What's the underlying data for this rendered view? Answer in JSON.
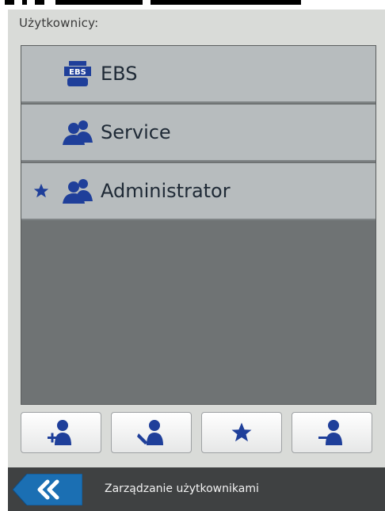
{
  "header": {
    "title": "Użytkownicy:"
  },
  "users": [
    {
      "label": "EBS",
      "icon": "ebs-user-icon",
      "starred": false
    },
    {
      "label": "Service",
      "icon": "users-icon",
      "starred": false
    },
    {
      "label": "Administrator",
      "icon": "users-icon",
      "starred": true
    }
  ],
  "toolbar": {
    "buttons": [
      {
        "icon": "add-user-icon"
      },
      {
        "icon": "edit-user-icon"
      },
      {
        "icon": "star-icon"
      },
      {
        "icon": "remove-user-icon"
      }
    ]
  },
  "bottom_bar": {
    "back_icon": "double-chevron-left-icon",
    "title": "Zarządzanie użytkownikami"
  },
  "colors": {
    "icon_blue": "#1f3f9a",
    "bar_dark": "#3f4142",
    "back_blue": "#1b6fb3"
  }
}
